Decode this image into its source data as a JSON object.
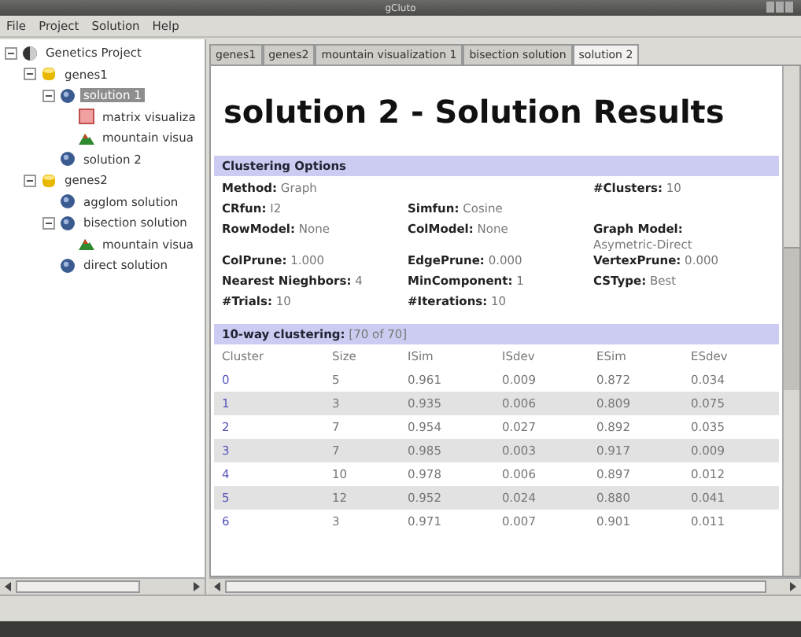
{
  "window": {
    "title": "gCluto"
  },
  "menu": [
    "File",
    "Project",
    "Solution",
    "Help"
  ],
  "tree": [
    {
      "label": "Genetics Project",
      "kind": "project",
      "expanded": true,
      "selected": false,
      "children": [
        {
          "label": "genes1",
          "kind": "genes",
          "expanded": true,
          "selected": false,
          "children": [
            {
              "label": "solution 1",
              "kind": "solution",
              "expanded": true,
              "selected": true,
              "children": [
                {
                  "label": "matrix visualiza",
                  "kind": "matrix",
                  "selected": false
                },
                {
                  "label": "mountain visua",
                  "kind": "mountain",
                  "selected": false
                }
              ]
            },
            {
              "label": "solution 2",
              "kind": "solution",
              "selected": false
            }
          ]
        },
        {
          "label": "genes2",
          "kind": "genes",
          "expanded": true,
          "selected": false,
          "children": [
            {
              "label": "agglom solution",
              "kind": "solution",
              "selected": false
            },
            {
              "label": "bisection solution",
              "kind": "solution",
              "expanded": true,
              "selected": false,
              "children": [
                {
                  "label": "mountain visua",
                  "kind": "mountain",
                  "selected": false
                }
              ]
            },
            {
              "label": "direct solution",
              "kind": "solution",
              "selected": false
            }
          ]
        }
      ]
    }
  ],
  "tabs": [
    {
      "label": "genes1",
      "selected": false
    },
    {
      "label": "genes2",
      "selected": false
    },
    {
      "label": "mountain visualization 1",
      "selected": false
    },
    {
      "label": "bisection solution",
      "selected": false
    },
    {
      "label": "solution 2",
      "selected": true
    }
  ],
  "heading": "solution 2 - Solution Results",
  "options": {
    "title": "Clustering Options",
    "rows": [
      {
        "left": {
          "label": "Method:",
          "value": "Graph"
        },
        "right": {
          "label": "#Clusters:",
          "value": "10"
        }
      },
      {
        "left": {
          "label": "CRfun:",
          "value": "I2"
        },
        "middle": {
          "label": "Simfun:",
          "value": "Cosine"
        }
      },
      {
        "left": {
          "label": "RowModel:",
          "value": "None"
        },
        "middle": {
          "label": "ColModel:",
          "value": "None"
        },
        "right": {
          "label": "Graph Model:",
          "value": "Asymetric-Direct"
        }
      },
      {
        "left": {
          "label": "ColPrune:",
          "value": "1.000"
        },
        "middle": {
          "label": "EdgePrune:",
          "value": "0.000"
        },
        "right": {
          "label": "VertexPrune:",
          "value": "0.000"
        }
      },
      {
        "left": {
          "label": "Nearest Nieghbors:",
          "value": "4"
        },
        "middle": {
          "label": "MinComponent:",
          "value": "1"
        },
        "right": {
          "label": "CSType:",
          "value": "Best"
        }
      },
      {
        "left": {
          "label": "#Trials:",
          "value": "10"
        },
        "middle": {
          "label": "#Iterations:",
          "value": "10"
        }
      }
    ]
  },
  "clustering": {
    "title": "10-way clustering:",
    "note": "[70 of 70]",
    "columns": [
      "Cluster",
      "Size",
      "ISim",
      "ISdev",
      "ESim",
      "ESdev"
    ],
    "rows": [
      [
        "0",
        "5",
        "0.961",
        "0.009",
        "0.872",
        "0.034"
      ],
      [
        "1",
        "3",
        "0.935",
        "0.006",
        "0.809",
        "0.075"
      ],
      [
        "2",
        "7",
        "0.954",
        "0.027",
        "0.892",
        "0.035"
      ],
      [
        "3",
        "7",
        "0.985",
        "0.003",
        "0.917",
        "0.009"
      ],
      [
        "4",
        "10",
        "0.978",
        "0.006",
        "0.897",
        "0.012"
      ],
      [
        "5",
        "12",
        "0.952",
        "0.024",
        "0.880",
        "0.041"
      ],
      [
        "6",
        "3",
        "0.971",
        "0.007",
        "0.901",
        "0.011"
      ]
    ]
  }
}
